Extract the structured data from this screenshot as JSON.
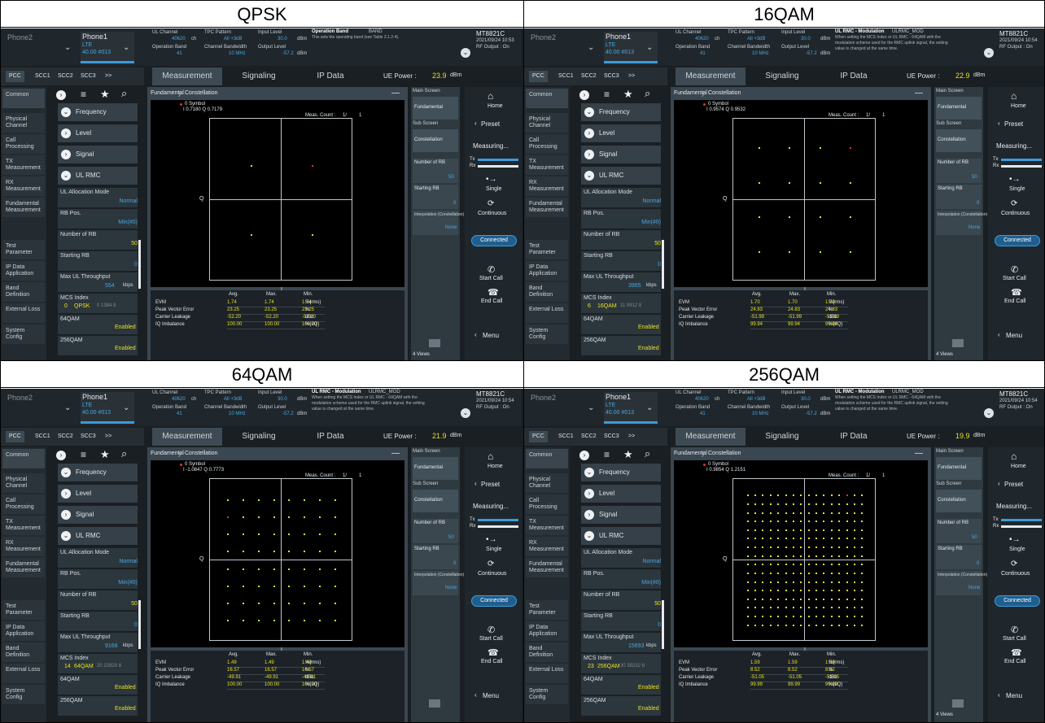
{
  "cells": [
    {
      "title": "QPSK",
      "ue_power": "23.9",
      "symbol": "I 0.7180 Q 0.7179",
      "mod_index": "0",
      "mod_name": "QPSK",
      "mod_tail": "0  1384  8",
      "throughput": "554",
      "evm": [
        "1.74",
        "1.74",
        "1.74"
      ],
      "pve": [
        "23.25",
        "23.25",
        "23.25"
      ],
      "cl": [
        "-52.20",
        "-52.20",
        "-52.20"
      ],
      "iq": [
        "100.00",
        "100.00",
        "100.00"
      ],
      "grid": 2,
      "op_title": "Operation Band",
      "op_tag": "BAND",
      "op_desc": "This sets the operating band (see Table 2.1.2-4).",
      "op_desc2": "",
      "op_desc3": "",
      "time": "2021/09/24 10:53",
      "views": "4 Views"
    },
    {
      "title": "16QAM",
      "ue_power": "22.9",
      "symbol": "I 0.9574 Q 0.9532",
      "mod_index": "6",
      "mod_name": "16QAM",
      "mod_tail": "11  9912  8",
      "throughput": "3965",
      "evm": [
        "1.70",
        "1.70",
        "1.70"
      ],
      "pve": [
        "24.83",
        "24.83",
        "24.83"
      ],
      "cl": [
        "-51.99",
        "-51.99",
        "-51.99"
      ],
      "iq": [
        "99.94",
        "99.94",
        "99.94"
      ],
      "grid": 4,
      "op_title": "UL RMC - Modulation",
      "op_tag": "ULRMC_MOD",
      "op_desc": "When setting the MCS Index or UL RMC - 64QAM with the",
      "op_desc2": "modulation scheme used for the RMC uplink signal, the setting",
      "op_desc3": "value is changed at the same time.",
      "time": "2021/09/24 10:54",
      "views": "4 Views"
    },
    {
      "title": "64QAM",
      "ue_power": "21.9",
      "symbol": "I -1.0847 Q 0.7773",
      "mod_index": "14",
      "mod_name": "64QAM",
      "mod_tail": "20  22920  8",
      "throughput": "9168",
      "evm": [
        "1.49",
        "1.49",
        "1.49"
      ],
      "pve": [
        "16.57",
        "16.57",
        "16.57"
      ],
      "cl": [
        "-49.91",
        "-49.91",
        "-49.91"
      ],
      "iq": [
        "100.00",
        "100.00",
        "100.00"
      ],
      "grid": 8,
      "op_title": "UL RMC - Modulation",
      "op_tag": "ULRMC_MOD",
      "op_desc": "When setting the MCS Index or UL RMC - 64QAM with the",
      "op_desc2": "modulation scheme used for the RMC uplink signal, the setting",
      "op_desc3": "value is changed at the same time.",
      "time": "2021/09/24 10:54",
      "views": ""
    },
    {
      "title": "256QAM",
      "ue_power": "19.9",
      "symbol": "I 0.9854 Q 1.2151",
      "mod_index": "23",
      "mod_name": "256QAM",
      "mod_tail": "30  39232  8",
      "throughput": "15693",
      "evm": [
        "1.59",
        "1.59",
        "1.59"
      ],
      "pve": [
        "8.52",
        "8.52",
        "8.52"
      ],
      "cl": [
        "-51.05",
        "-51.05",
        "-51.05"
      ],
      "iq": [
        "99.99",
        "99.99",
        "99.99"
      ],
      "grid": 16,
      "op_title": "UL RMC - Modulation",
      "op_tag": "ULRMC_MOD",
      "op_desc": "When setting the MCS Index or UL RMC - 64QAM with the",
      "op_desc2": "modulation scheme used for the RMC uplink signal, the setting",
      "op_desc3": "value is changed at the same time.",
      "time": "2021/09/24 10:54",
      "views": "4 Views"
    }
  ],
  "common": {
    "phone2": "Phone2",
    "phone1": "Phone1",
    "lte": "LTE",
    "freq": "40.00 #013",
    "ul_channel": "UL Channel",
    "ul_channel_val": "40620",
    "ul_unit": "ch",
    "op_band": "Operation Band",
    "op_band_val": "41",
    "tpc": "TPC Pattern",
    "tpc_val": "All +3dB",
    "ch_bw": "Channel Bandwidth",
    "ch_bw_val": "10 MHz",
    "input_level": "Input Level",
    "input_val": "30.0",
    "input_unit": "dBm",
    "output_level": "Output Level",
    "output_val": "-57.2",
    "output_unit": "dBm",
    "brand": "MT8821C",
    "rf": "RF Output : On",
    "ca": [
      "PCC",
      "SCC1",
      "SCC2",
      "SCC3",
      ">>"
    ],
    "tabs": [
      "Measurement",
      "Signaling",
      "IP Data"
    ],
    "ue_power_label": "UE Power :",
    "ue_power_unit": "dBm",
    "left_nav": [
      "Common",
      "Physical Channel",
      "Call Processing",
      "TX Measurement",
      "RX Measurement",
      "Fundamental Measurement",
      "",
      "Test Parameter",
      "IP Data Application",
      "Band Definition",
      "External Loss",
      "System Config"
    ],
    "menu": {
      "frequency": "Frequency",
      "level": "Level",
      "signal": "Signal",
      "ul_rmc": "UL RMC",
      "alloc_mode": "UL Allocation Mode",
      "alloc_val": "Normal",
      "rb_pos": "RB Pos.",
      "rb_pos_val": "Min(#0)",
      "num_rb": "Number of RB",
      "num_rb_val": "50",
      "start_rb": "Starting RB",
      "start_rb_val": "0",
      "max_tp": "Max UL Throughput",
      "kbps": "kbps",
      "mcs": "MCS Index",
      "q64": "64QAM",
      "q64_val": "Enabled",
      "q256": "256QAM",
      "q256_val": "Enabled",
      "dl_rmc": "DL RMC",
      "tdd": "TDD"
    },
    "breadcrumb1": "Fundamental",
    "breadcrumb2": "Constellation",
    "symbol_label": "0 Symbol",
    "meas_count": "Meas. Count :",
    "meas_val": "1/",
    "meas_total": "1",
    "axis_q": "Q",
    "axis_i": "I",
    "table_head": [
      "Avg.",
      "Max.",
      "Min."
    ],
    "rows": [
      "EVM",
      "Peak Vector Error",
      "Carrier Leakage",
      "IQ Imbalance"
    ],
    "units": [
      "%(rms)",
      "%",
      "dBc",
      "%(I/Q)"
    ],
    "side_panel": {
      "main_screen": "Main Screen",
      "fundamental": "Fundamental",
      "sub_screen": "Sub Screen",
      "constellation": "Constellation",
      "num_rb": "Number of RB",
      "num_rb_val": "50",
      "start_rb": "Starting RB",
      "start_rb_val": "0",
      "interp": "Interpolation (Constellation)",
      "interp_val": "None"
    },
    "right_btns": {
      "home": "Home",
      "preset": "Preset",
      "measuring": "Measuring...",
      "tx": "Tx",
      "rx": "Rx",
      "single": "Single",
      "continuous": "Continuous",
      "connected": "Connected",
      "start_call": "Start Call",
      "end_call": "End Call",
      "menu": "Menu"
    }
  },
  "colors": {
    "accent": "#3b9bdc",
    "trace": "#e8de2a",
    "marker": "#e03030",
    "bg": "#1a1f23"
  }
}
